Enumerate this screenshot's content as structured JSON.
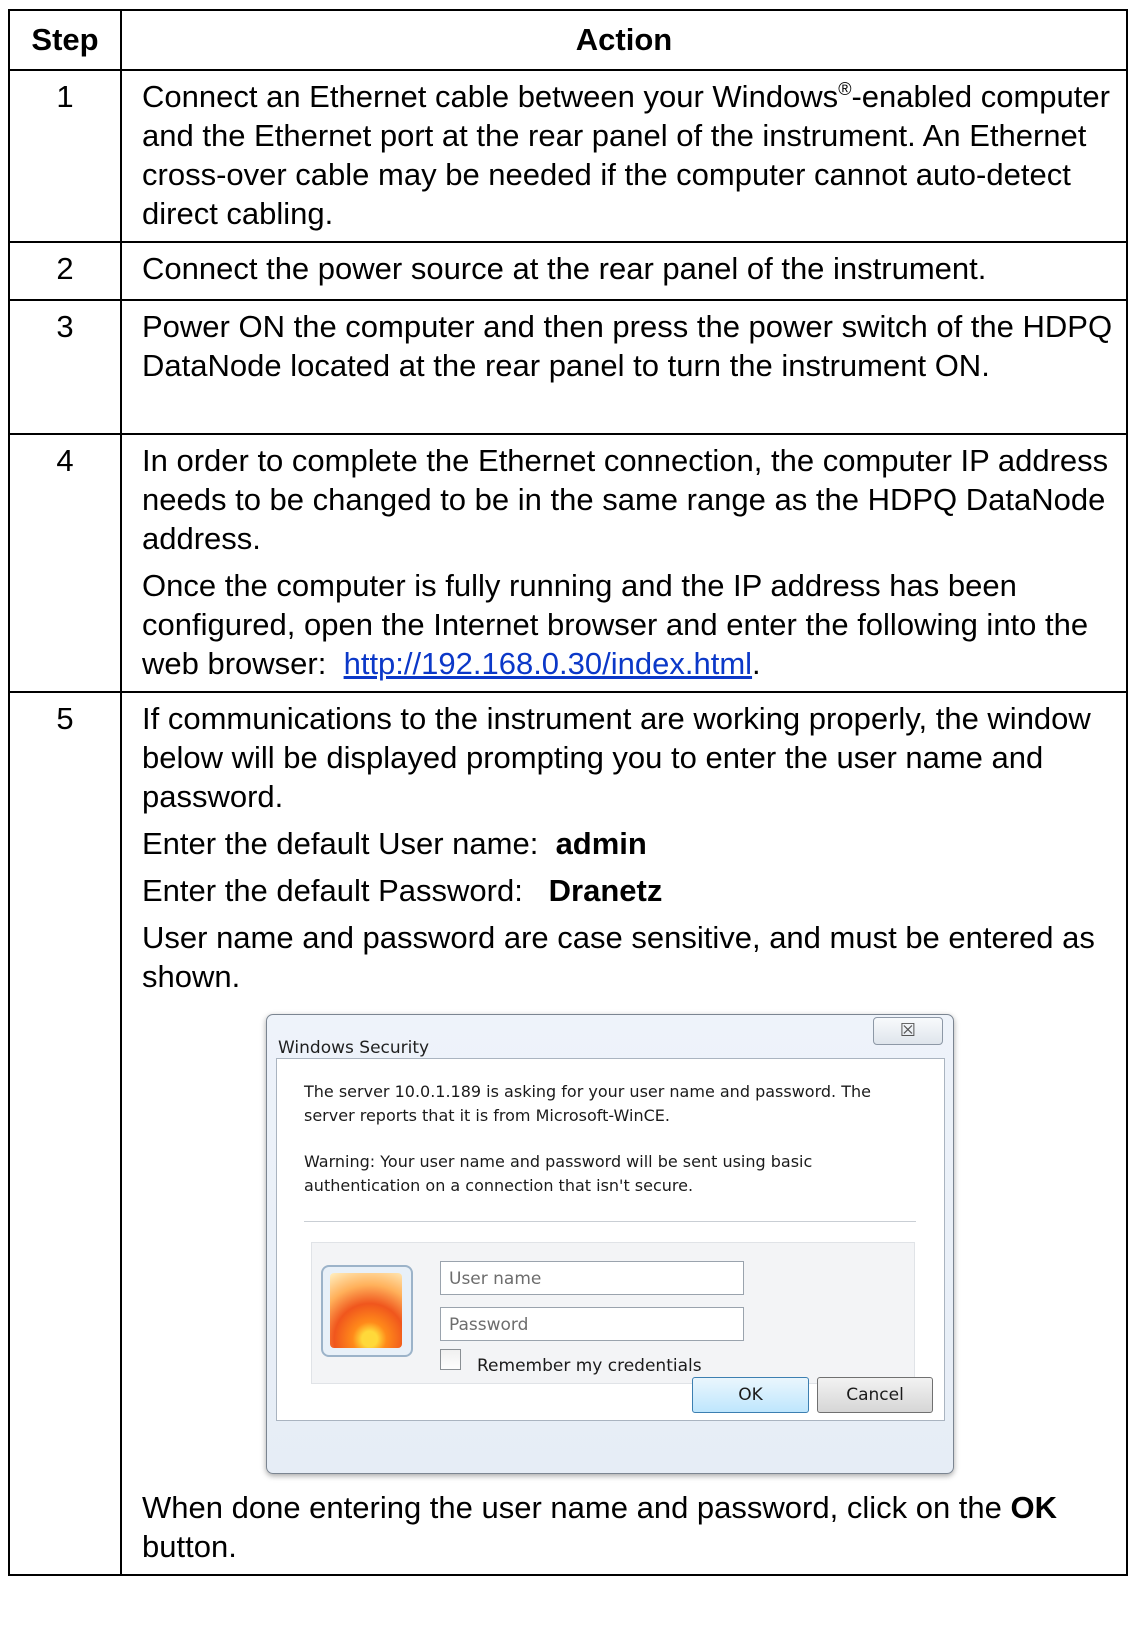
{
  "table": {
    "headers": {
      "step": "Step",
      "action": "Action"
    },
    "rows": [
      {
        "step": "1",
        "text_pre": "Connect an Ethernet cable between your Windows",
        "sup": "®",
        "text_post": "-enabled computer and the Ethernet port at the rear panel of the instrument. An Ethernet cross-over cable may be needed if the computer cannot auto-detect direct cabling."
      },
      {
        "step": "2",
        "text": "Connect the power source at the rear panel of the instrument."
      },
      {
        "step": "3",
        "text": "Power ON the computer and then press the power switch of the HDPQ DataNode located at the rear panel to turn the instrument ON."
      },
      {
        "step": "4",
        "p1": "In order to complete the Ethernet connection, the computer IP address needs to be changed to be in the same range as the HDPQ DataNode address.",
        "p2_pre": "Once the computer is fully running and the IP address has been configured, open the Internet browser and enter the following into the web browser:",
        "link": "http://192.168.0.30/index.html",
        "p2_post": "."
      },
      {
        "step": "5",
        "p1": "If communications to the instrument are working properly, the window below will be displayed prompting you to enter the user name and password.",
        "user_label": "Enter the default User name:",
        "user_value": "admin",
        "pass_label": "Enter the default Password:",
        "pass_value": "Dranetz",
        "p_case": "User name and password are case sensitive, and must be entered as shown.",
        "final_pre": "When done entering the user name and password, click on the",
        "final_bold": "OK",
        "final_post": "button."
      }
    ]
  },
  "dialog": {
    "title": "Windows Security",
    "close_glyph": "☒",
    "message": "The server 10.0.1.189 is asking for your user name and password. The server reports that it is from Microsoft-WinCE.",
    "warning": "Warning: Your user name and password will be sent using basic authentication on a connection that isn't secure.",
    "username_placeholder": "User name",
    "password_placeholder": "Password",
    "remember_label": "Remember my credentials",
    "ok_label": "OK",
    "cancel_label": "Cancel"
  }
}
